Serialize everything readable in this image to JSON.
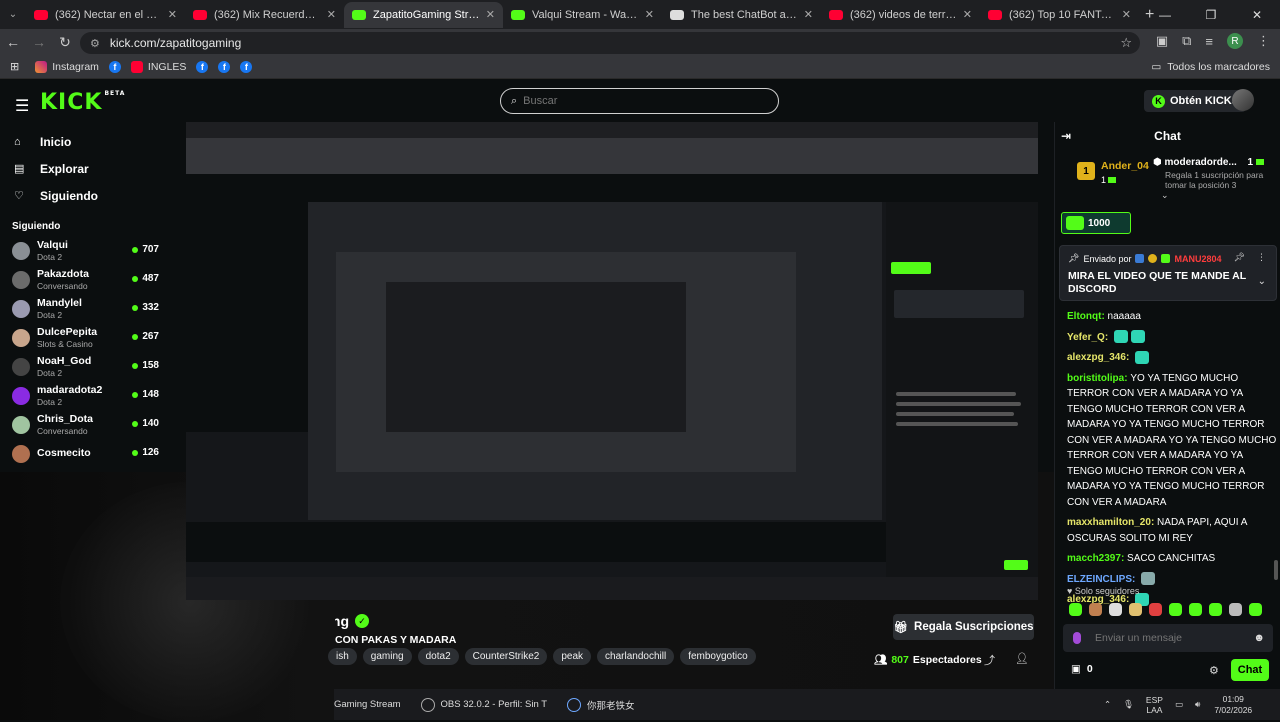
{
  "browser": {
    "tabs": [
      {
        "title": "(362) Nectar en el Cielo/ capitulo",
        "color": "#ff0033"
      },
      {
        "title": "(362) Mix Recuerdos - Son del M",
        "color": "#ff0033"
      },
      {
        "title": "ZapatitoGaming Stream - Watch",
        "color": "#53fc18",
        "active": true
      },
      {
        "title": "Valqui Stream - Watch Live on K",
        "color": "#53fc18"
      },
      {
        "title": "The best ChatBot and Widgets",
        "color": "#dddddd"
      },
      {
        "title": "(362) videos de terror dross - Y",
        "color": "#ff0033"
      },
      {
        "title": "(362) Top 10 FANTASMAS Capt",
        "color": "#ff0033"
      }
    ],
    "url": "kick.com/zapatitogaming",
    "profile_initial": "R",
    "bookmarks": {
      "instagram": "Instagram",
      "ingles": "INGLES",
      "all": "Todos los marcadores"
    }
  },
  "nav": {
    "logo": "KICK",
    "logo_beta": "BETA",
    "search_placeholder": "Buscar",
    "kicks_label": "Obtén KICKs"
  },
  "sidebar": {
    "items": [
      {
        "label": "Inicio",
        "icon": "home-icon"
      },
      {
        "label": "Explorar",
        "icon": "browse-icon"
      },
      {
        "label": "Siguiendo",
        "icon": "heart-icon"
      }
    ],
    "following_title": "Siguiendo",
    "channels": [
      {
        "name": "Valqui",
        "category": "Dota 2",
        "viewers": "707",
        "color": "#8a8f95"
      },
      {
        "name": "Pakazdota",
        "category": "Conversando",
        "viewers": "487",
        "color": "#6b6b6b"
      },
      {
        "name": "Mandylel",
        "category": "Dota 2",
        "viewers": "332",
        "color": "#9a9ab0"
      },
      {
        "name": "DulcePepita",
        "category": "Slots & Casino",
        "viewers": "267",
        "color": "#c8a58c"
      },
      {
        "name": "NoaH_God",
        "category": "Dota 2",
        "viewers": "158",
        "color": "#444"
      },
      {
        "name": "madaradota2",
        "category": "Dota 2",
        "viewers": "148",
        "color": "#8a2be2"
      },
      {
        "name": "Chris_Dota",
        "category": "Conversando",
        "viewers": "140",
        "color": "#a0c4a0"
      },
      {
        "name": "Cosmecito",
        "category": "",
        "viewers": "126",
        "color": "#b07050"
      }
    ]
  },
  "stream": {
    "streamer": "ZapatitoGaming",
    "title": "CON PAKAS Y MADARA",
    "tags": [
      "ish",
      "gaming",
      "dota2",
      "CounterStrike2",
      "peak",
      "charlandochill",
      "femboygotico"
    ],
    "subs_button": "Regala Suscripciones",
    "viewers": "807",
    "viewers_label": "Espectadores"
  },
  "taskbar": {
    "item1": "Gaming Stream",
    "item2": "OBS 32.0.2 - Perfil: Sin T",
    "item3": "你那老铁女",
    "lang": "ESP",
    "region": "LAA",
    "time": "01:09",
    "date": "7/02/2026"
  },
  "chat": {
    "title": "Chat",
    "leader": {
      "rank": "1",
      "name": "Ander_04",
      "count": "1"
    },
    "moderator": {
      "name": "moderadorde...",
      "count": "1",
      "sub": "Regala 1 suscripción para tomar la posición 3"
    },
    "kicks_amount": "1000",
    "pinned": {
      "sent_by": "Enviado por",
      "user": "MANU2804",
      "message": "MIRA EL VIDEO QUE TE MANDE AL DISCORD"
    },
    "messages": [
      {
        "user": "Eltonqt",
        "color": "#53fc18",
        "text": "naaaaa",
        "emotes": 0
      },
      {
        "user": "Yefer_Q",
        "color": "#e6e66a",
        "text": "",
        "emotes": 2
      },
      {
        "user": "alexzpg_346",
        "color": "#e6e66a",
        "text": "",
        "emotes": 1
      },
      {
        "user": "boristitolipa",
        "color": "#53fc18",
        "text": "YO YA TENGO MUCHO TERROR CON VER A MADARA YO YA TENGO MUCHO TERROR CON VER A MADARA YO YA TENGO MUCHO TERROR CON VER A MADARA YO YA TENGO MUCHO TERROR CON VER A MADARA YO YA TENGO MUCHO TERROR CON VER A MADARA YO YA TENGO MUCHO TERROR CON VER A MADARA",
        "emotes": 0
      },
      {
        "user": "maxxhamilton_20",
        "color": "#e6e66a",
        "text": "NADA PAPI, AQUI A OSCURAS SOLITO MI REY",
        "emotes": 0
      },
      {
        "user": "macch2397",
        "color": "#53fc18",
        "text": "SACO CANCHITAS",
        "emotes": 0
      },
      {
        "user": "ELZEINCLIPS",
        "color": "#6ea8ff",
        "text": "",
        "emotes": 1
      },
      {
        "user": "alexzpg_346",
        "color": "#e6e66a",
        "text": "",
        "emotes": 1
      }
    ],
    "followers_only": "Solo seguidores",
    "input_placeholder": "Enviar un mensaje",
    "points": "0",
    "send_button": "Chat"
  }
}
